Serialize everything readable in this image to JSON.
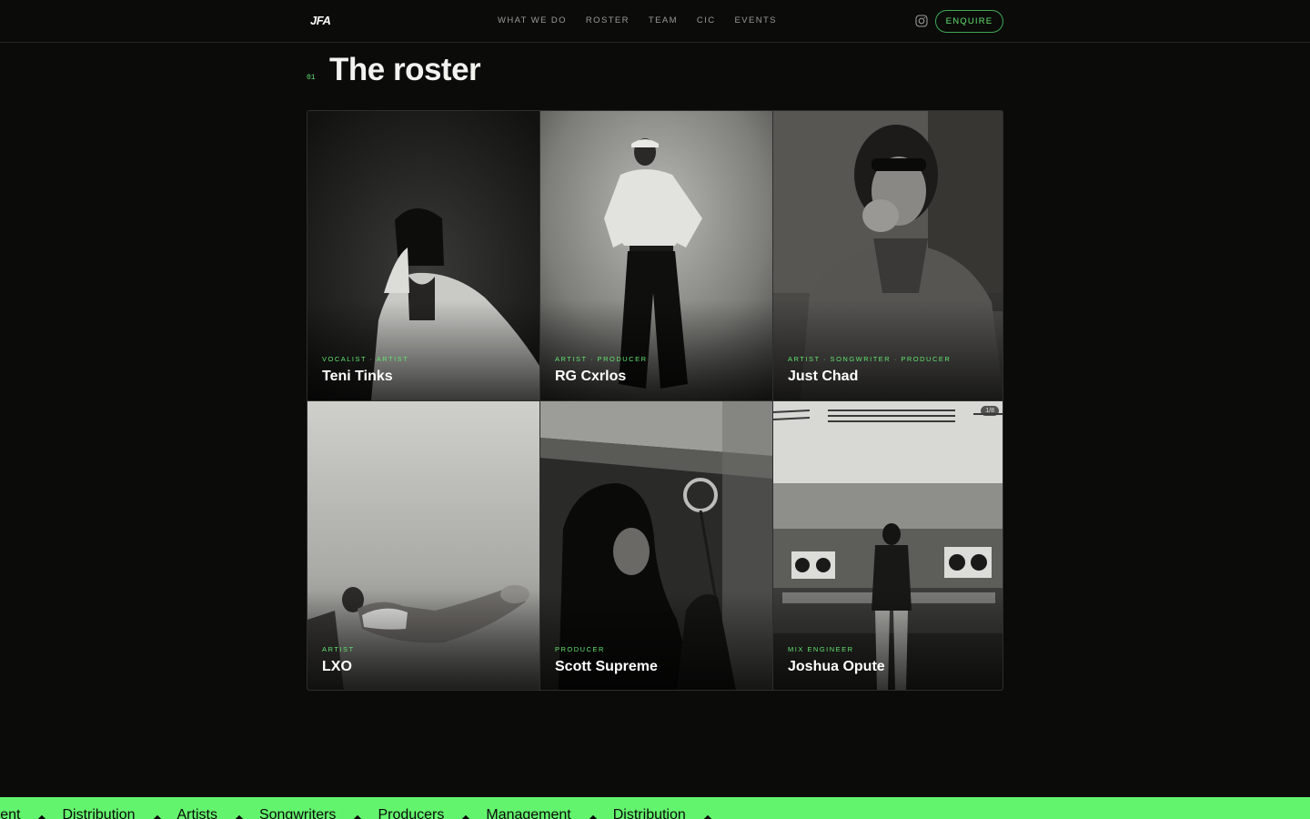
{
  "header": {
    "logo": "JFA",
    "nav": [
      "WHAT WE DO",
      "ROSTER",
      "TEAM",
      "CIC",
      "EVENTS"
    ],
    "instagram_icon": "instagram-icon",
    "enquire_label": "ENQUIRE"
  },
  "section": {
    "number": "01",
    "title": "The roster"
  },
  "roster": [
    {
      "role": "VOCALIST · ARTIST",
      "name": "Teni Tinks"
    },
    {
      "role": "ARTIST · PRODUCER",
      "name": "RG Cxrlos"
    },
    {
      "role": "ARTIST · SONGWRITER · PRODUCER",
      "name": "Just Chad"
    },
    {
      "role": "ARTIST",
      "name": "LXO"
    },
    {
      "role": "PRODUCER",
      "name": "Scott Supreme"
    },
    {
      "role": "MIX ENGINEER",
      "name": "Joshua Opute",
      "badge": "1/8"
    }
  ],
  "ticker": {
    "items": [
      "ement",
      "Distribution",
      "Artists",
      "Songwriters",
      "Producers",
      "Management",
      "Distribution"
    ]
  },
  "colors": {
    "accent": "#63e36f",
    "ticker_bg": "#63f46e",
    "background": "#0b0b0a"
  }
}
